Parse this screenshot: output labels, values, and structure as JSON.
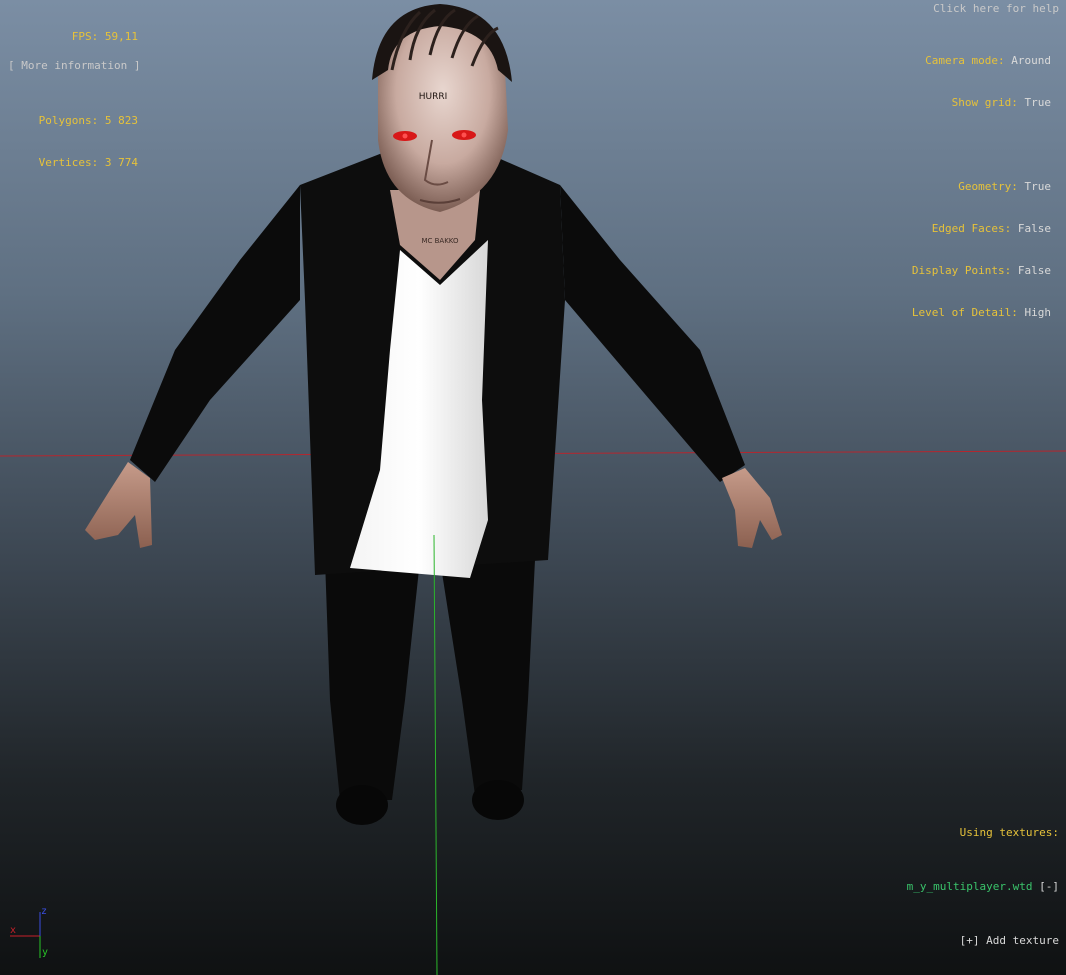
{
  "stats": {
    "fps_label": "FPS:",
    "fps_value": "59,11",
    "polygons_label": "Polygons:",
    "polygons_value": "5 823",
    "vertices_label": "Vertices:",
    "vertices_value": "3 774",
    "more_info": "[ More information ]"
  },
  "help": "Click here for help",
  "settings": {
    "camera_mode_label": "Camera mode:",
    "camera_mode_value": "Around",
    "show_grid_label": "Show grid:",
    "show_grid_value": "True",
    "geometry_label": "Geometry:",
    "geometry_value": "True",
    "edged_faces_label": "Edged Faces:",
    "edged_faces_value": "False",
    "display_points_label": "Display Points:",
    "display_points_value": "False",
    "lod_label": "Level of Detail:",
    "lod_value": "High"
  },
  "model": {
    "tattoo_head": "HURRI",
    "tattoo_neck": "MC BAKKO"
  },
  "textures": {
    "heading": "Using textures:",
    "items": [
      {
        "name": "m_y_multiplayer.wtd",
        "remove": "[-]"
      }
    ],
    "add": "[+] Add texture"
  },
  "gizmo": {
    "x": "x",
    "y": "y",
    "z": "z"
  },
  "colors": {
    "label": "#e6c23a",
    "value": "#d9d9d9",
    "texture": "#3ac46b",
    "axis_x": "#c8202a",
    "axis_y": "#28c428",
    "axis_z": "#3a4ee0"
  }
}
